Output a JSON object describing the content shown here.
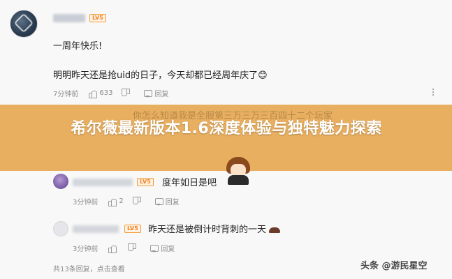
{
  "comment": {
    "level_badge": "LV5",
    "line1": "一周年快乐!",
    "line2": "明明昨天还是抢uid的日子，今天却都已经周年庆了",
    "emoji": "😊",
    "time": "7分钟前",
    "likes": "633",
    "reply_label": "回复"
  },
  "banner": {
    "bg_text": "你怎么知道我是全服第三万三万三百四十二个玩家",
    "title": "希尔薇最新版本1.6深度体验与独特魅力探索"
  },
  "replies": [
    {
      "level_badge": "LV5",
      "text": "度年如日是吧",
      "time": "3分钟前",
      "likes": "2",
      "reply_label": "回复"
    },
    {
      "level_badge": "LV5",
      "text": "昨天还是被倒计时背刺的一天",
      "time": "3分钟前",
      "likes": "",
      "reply_label": "回复"
    }
  ],
  "footer": {
    "summary": "共13条回复，点击查看"
  },
  "watermark": "头条 @游民星空",
  "colors": {
    "banner": "#e5a348",
    "badge": "#f2811e"
  },
  "icons": [
    "thumb-up-icon",
    "thumb-down-icon",
    "reply-icon",
    "more-icon"
  ]
}
